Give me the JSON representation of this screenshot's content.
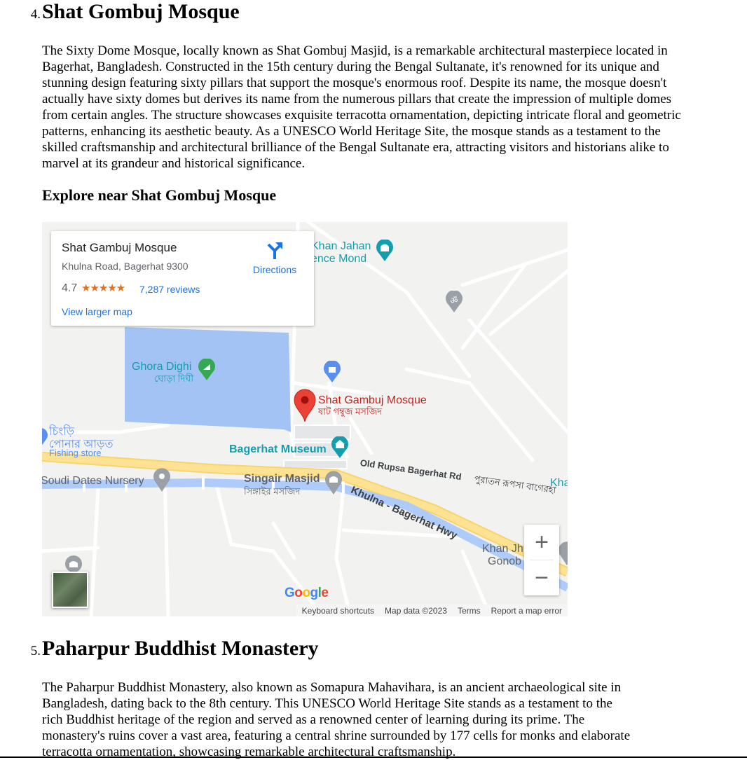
{
  "section4": {
    "number": "4.",
    "title": "Shat Gombuj Mosque",
    "paragraph": "The Sixty Dome Mosque, locally known as Shat Gombuj Masjid, is a remarkable architectural masterpiece located in Bagerhat, Bangladesh. Constructed in the 15th century during the Bengal Sultanate, it's renowned for its unique and stunning design featuring sixty pillars that support the mosque's enormous roof. Despite its name, the mosque doesn't actually have sixty domes but derives its name from the numerous pillars that create the impression of multiple domes from certain angles. The structure showcases exquisite terracotta ornamentation, depicting intricate floral and geometric patterns, enhancing its aesthetic beauty. As a UNESCO World Heritage Site, the mosque stands as a testament to the skilled craftsmanship and architectural brilliance of the Bengal Sultanate era, attracting visitors and historians alike to marvel at its grandeur and historical significance.",
    "explore_heading": "Explore near Shat Gombuj Mosque"
  },
  "map": {
    "card": {
      "name": "Shat Gambuj Mosque",
      "address": "Khulna Road, Bagerhat 9300",
      "rating": "4.7",
      "stars": "★★★★★",
      "reviews": "7,287 reviews",
      "larger_map": "View larger map",
      "directions": "Directions"
    },
    "labels": {
      "khan_jahan_1": "Khan Jahan",
      "khan_jahan_2": "ence Mond",
      "ghora_dighi": "Ghora Dighi",
      "ghora_dighi_bn": "ঘোড়া দিঘী",
      "mosque_en": "Shat Gambuj Mosque",
      "mosque_bn": "ষাট গম্বুজ মসজিদ",
      "chingri_1": "চিংড়ি",
      "chingri_2": "পোনার আড়ত",
      "fishing_store": "Fishing store",
      "museum": "Bagerhat Museum",
      "old_rupsa": "Old Rupsa Bagerhat Rd",
      "old_rupsa_bn": "পুরাতন রূপসা বাগেরহা",
      "kha": "Kha",
      "soudi": "Soudi Dates Nursery",
      "singair_en": "Singair Masjid",
      "singair_bn": "সিঙ্গাইর মসজিদ",
      "highway": "Khulna - Bagerhat Hwy",
      "khan_jh": "Khan Jh",
      "gonob": "Gonob"
    },
    "zoom_in": "+",
    "zoom_out": "−",
    "google": "Google",
    "footer": {
      "shortcuts": "Keyboard shortcuts",
      "data": "Map data ©2023",
      "terms": "Terms",
      "report": "Report a map error"
    },
    "colors": {
      "water": "#a4c3f5",
      "road_major": "#fde293",
      "road_blue": "#aecbfa",
      "marker": "#ea4335",
      "teal": "#129eaf",
      "link": "#1a73e8"
    }
  },
  "section5": {
    "number": "5.",
    "title": "Paharpur Buddhist Monastery",
    "paragraph": "The Paharpur Buddhist Monastery, also known as Somapura Mahavihara, is an ancient archaeological site in Bangladesh, dating back to the 8th century. This UNESCO World Heritage Site stands as a testament to the rich Buddhist heritage of the region and served as a renowned center of learning during its prime. The monastery's ruins cover a vast area, featuring a central shrine surrounded by 177 cells for monks and elaborate terracotta ornamentation, showcasing remarkable architectural craftsmanship."
  }
}
